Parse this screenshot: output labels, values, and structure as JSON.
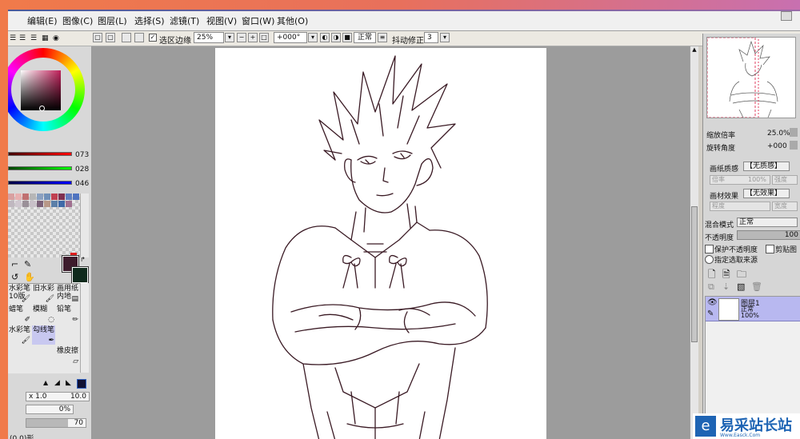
{
  "app": {
    "title": "SAI"
  },
  "menu": [
    "编辑(E)",
    "图像(C)",
    "图层(L)",
    "选择(S)",
    "滤镜(T)",
    "视图(V)",
    "窗口(W)",
    "其他(O)"
  ],
  "toolbar": {
    "select_edge_label": "选区边缘",
    "zoom_value": "25%",
    "rotation_value": "+000°",
    "blend_mode": "正常",
    "stabilizer_label": "抖动修正",
    "stabilizer_value": "3"
  },
  "color": {
    "r_value": "073",
    "g_value": "028",
    "b_value": "046",
    "foreground": "#3d1c2c",
    "background": "#0f2a1c",
    "swatches": [
      "#d9a0a0",
      "#e8b0b0",
      "#c07070",
      "#b6b6b6",
      "#8aa0c0",
      "#7090b8",
      "#c04050",
      "#803050",
      "#6080c0",
      "#4f74c0",
      "#c0b8c0",
      "#d0c8d0",
      "#9a9098",
      "#c8c0c8",
      "#7a6078",
      "#b89888",
      "#5b7fa8",
      "#3f6aa8",
      "#a07090"
    ],
    "accent_red": "#e02020"
  },
  "brush": {
    "tools": [
      {
        "label": "水彩笔 10版",
        "icon": "brush-icon"
      },
      {
        "label": "旧水彩",
        "icon": "brush-icon"
      },
      {
        "label": "画用纸 内地",
        "icon": "paper-icon"
      },
      {
        "label": "蜡笔",
        "icon": "crayon-icon"
      },
      {
        "label": "模糊",
        "icon": "blur-icon"
      },
      {
        "label": "铅笔",
        "icon": "pencil-icon"
      },
      {
        "label": "水彩笔",
        "icon": "brush-icon"
      },
      {
        "label": "勾线笔",
        "icon": "pen-icon"
      },
      {
        "label": "橡皮擦",
        "icon": "eraser-icon"
      }
    ],
    "size_prefix": "x 1.0",
    "size_value": "10.0",
    "min_size": "0%",
    "density": "70",
    "bottom_label": "(0.0)形"
  },
  "navigator": {
    "zoom_label": "缩放倍率",
    "zoom_value": "25.0%",
    "rotate_label": "旋转角度",
    "rotate_value": "+000"
  },
  "layer_props": {
    "paper_label": "画纸质感",
    "paper_value": "【无质感】",
    "scale_label": "倍率",
    "scale_value": "100%",
    "strength_label": "强度",
    "effect_label": "画材效果",
    "effect_value": "【无效果】",
    "degree_label": "程度",
    "width_label": "宽度",
    "blend_label": "混合模式",
    "blend_value": "正常",
    "opacity_label": "不透明度",
    "opacity_value": "100",
    "protect_alpha": "保护不透明度",
    "clip_label": "剪贴图",
    "select_source": "指定选取来源"
  },
  "layers": [
    {
      "name": "图层1",
      "mode": "正常",
      "opacity": "100%"
    }
  ],
  "watermark": {
    "text": "易采站长站",
    "sub": "Www.Easck.Com"
  }
}
